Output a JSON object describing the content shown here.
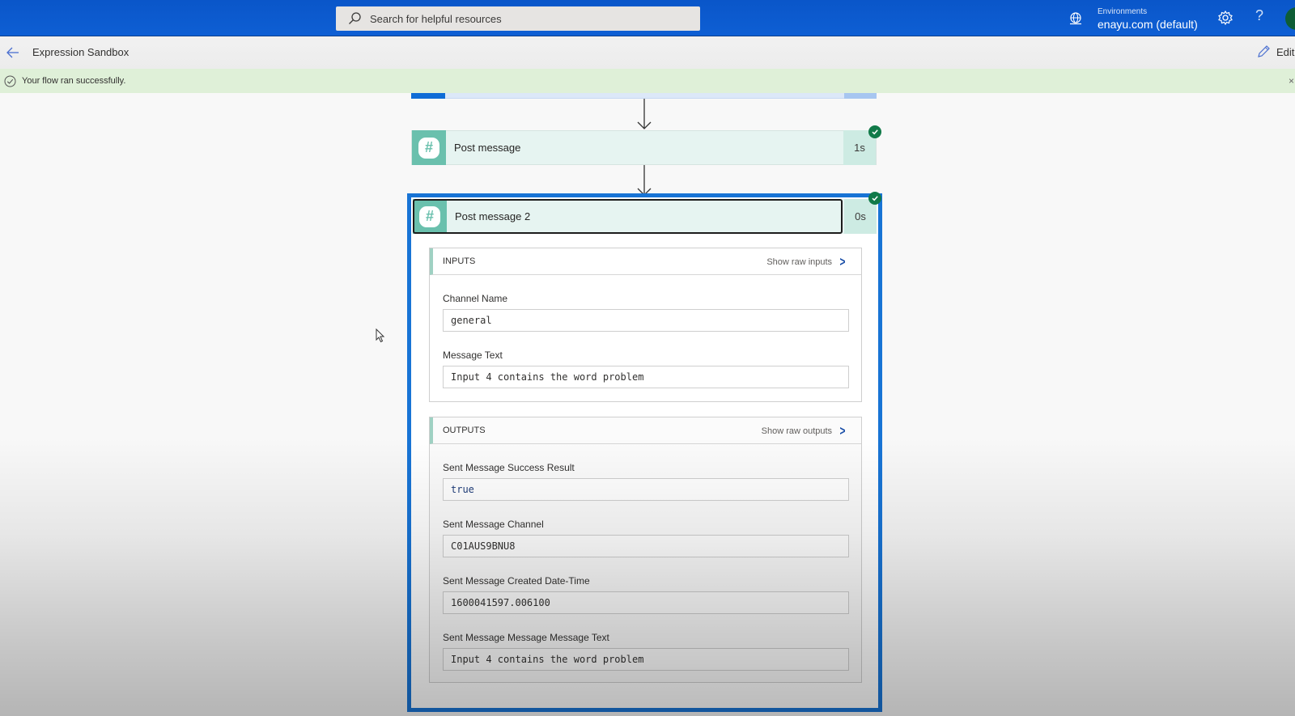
{
  "header": {
    "search_placeholder": "Search for helpful resources",
    "environment_label": "Environments",
    "environment_value": "enayu.com (default)",
    "help_label": "?"
  },
  "commandbar": {
    "title": "Expression Sandbox",
    "edit_label": "Edit"
  },
  "banner": {
    "message": "Your flow ran successfully.",
    "close_label": "×"
  },
  "flow": {
    "steps": [
      {
        "name": "Post message",
        "duration": "1s",
        "status": "succeeded",
        "icon": "slack-icon"
      },
      {
        "name": "Post message 2",
        "duration": "0s",
        "status": "succeeded",
        "icon": "slack-icon",
        "selected": true
      }
    ],
    "inputs": {
      "title": "INPUTS",
      "raw_link": "Show raw inputs",
      "fields": [
        {
          "label": "Channel Name",
          "value": "general"
        },
        {
          "label": "Message Text",
          "value": "Input 4 contains the word problem"
        }
      ]
    },
    "outputs": {
      "title": "OUTPUTS",
      "raw_link": "Show raw outputs",
      "fields": [
        {
          "label": "Sent Message Success Result",
          "value": "true"
        },
        {
          "label": "Sent Message Channel",
          "value": "C01AUS9BNU8"
        },
        {
          "label": "Sent Message Created Date-Time",
          "value": "1600041597.006100"
        },
        {
          "label": "Sent Message Message Message Text",
          "value": "Input 4 contains the word problem"
        }
      ]
    }
  },
  "colors": {
    "header_blue": "#0e5fd4",
    "success_banner": "#dff0d8",
    "slack_teal": "#6ac0ad",
    "selected_border": "#1874d5",
    "success_badge": "#117a49"
  }
}
